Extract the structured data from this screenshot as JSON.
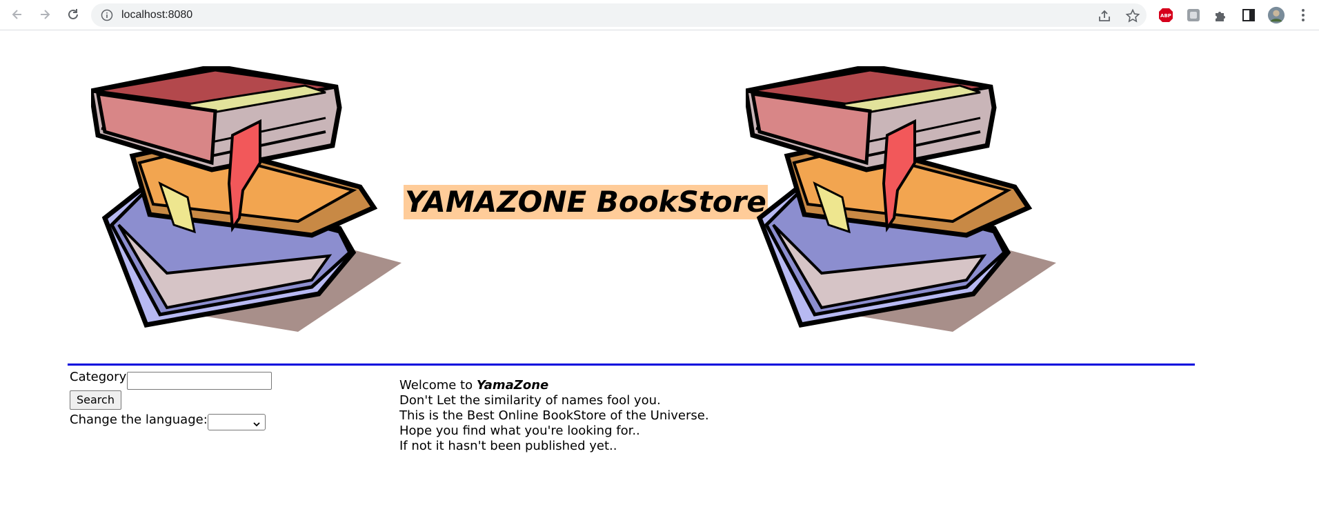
{
  "browser": {
    "url": "localhost:8080",
    "icons": [
      "back-icon",
      "forward-icon",
      "reload-icon",
      "site-info-icon",
      "share-icon",
      "bookmark-star-icon",
      "adblock-icon",
      "extension-icon",
      "puzzle-icon",
      "side-panel-icon",
      "profile-avatar",
      "menu-kebab-icon"
    ],
    "adblock_badge": "ABP"
  },
  "header": {
    "title": "YAMAZONE BookStore",
    "title_highlight_color": "#ffcc99",
    "divider_color": "#0000dd"
  },
  "form": {
    "category_label": "Category",
    "category_value": "",
    "search_label": "Search",
    "language_label": "Change the language:",
    "language_selected": ""
  },
  "welcome": {
    "prefix": "Welcome to ",
    "brand": "YamaZone",
    "line2": "Don't Let the similarity of names fool you.",
    "line3": "This is the Best Online BookStore of the Universe.",
    "line4": "Hope you find what you're looking for..",
    "line5": "If not it hasn't been published yet.."
  }
}
